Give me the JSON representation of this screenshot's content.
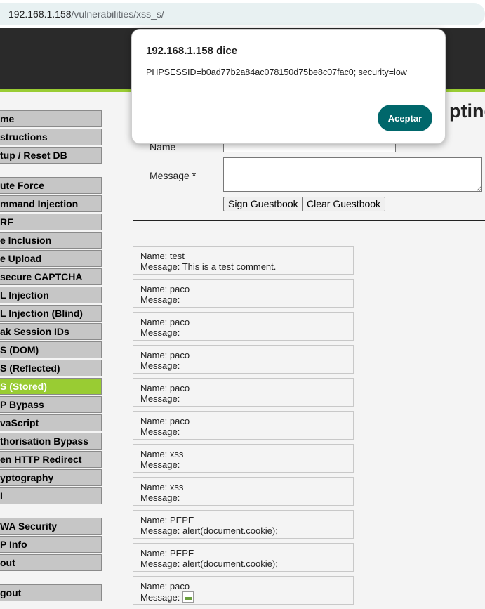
{
  "browser": {
    "url_host": "192.168.1.158",
    "url_path": "/vulnerabilities/xss_s/"
  },
  "sidebar": {
    "items": [
      {
        "label": "me"
      },
      {
        "label": "structions"
      },
      {
        "label": "tup / Reset DB"
      },
      {
        "label": "ute Force"
      },
      {
        "label": "mmand Injection"
      },
      {
        "label": "RF"
      },
      {
        "label": "e Inclusion"
      },
      {
        "label": "e Upload"
      },
      {
        "label": "secure CAPTCHA"
      },
      {
        "label": "L Injection"
      },
      {
        "label": "L Injection (Blind)"
      },
      {
        "label": "ak Session IDs"
      },
      {
        "label": "S (DOM)"
      },
      {
        "label": "S (Reflected)"
      },
      {
        "label": "S (Stored)"
      },
      {
        "label": "P Bypass"
      },
      {
        "label": "vaScript"
      },
      {
        "label": "thorisation Bypass"
      },
      {
        "label": "en HTTP Redirect"
      },
      {
        "label": "yptography"
      },
      {
        "label": "I"
      },
      {
        "label": "WA Security"
      },
      {
        "label": "P Info"
      },
      {
        "label": "out"
      },
      {
        "label": "gout"
      }
    ]
  },
  "main": {
    "title_fragment": "pting",
    "form": {
      "name_label": "Name",
      "message_label": "Message *",
      "sign_button": "Sign Guestbook",
      "clear_button": "Clear Guestbook"
    },
    "comments": [
      {
        "name": "Name: test",
        "message": "Message: This is a test comment."
      },
      {
        "name": "Name: paco",
        "message": "Message:"
      },
      {
        "name": "Name: paco",
        "message": "Message:"
      },
      {
        "name": "Name: paco",
        "message": "Message:"
      },
      {
        "name": "Name: paco",
        "message": "Message:"
      },
      {
        "name": "Name: paco",
        "message": "Message:"
      },
      {
        "name": "Name: xss",
        "message": "Message:"
      },
      {
        "name": "Name: xss",
        "message": "Message:"
      },
      {
        "name": "Name: PEPE",
        "message": "Message: alert(document.cookie);"
      },
      {
        "name": "Name: PEPE",
        "message": "Message: alert(document.cookie);"
      },
      {
        "name": "Name: paco",
        "message": "Message:"
      }
    ]
  },
  "dialog": {
    "title": "192.168.1.158 dice",
    "message": "PHPSESSID=b0ad77b2a84ac078150d75be8c07fac0; security=low",
    "ok_button": "Aceptar"
  },
  "colors": {
    "accent_green": "#99cc33",
    "header_dark": "#2a2a2a",
    "dialog_button": "#00676b"
  }
}
